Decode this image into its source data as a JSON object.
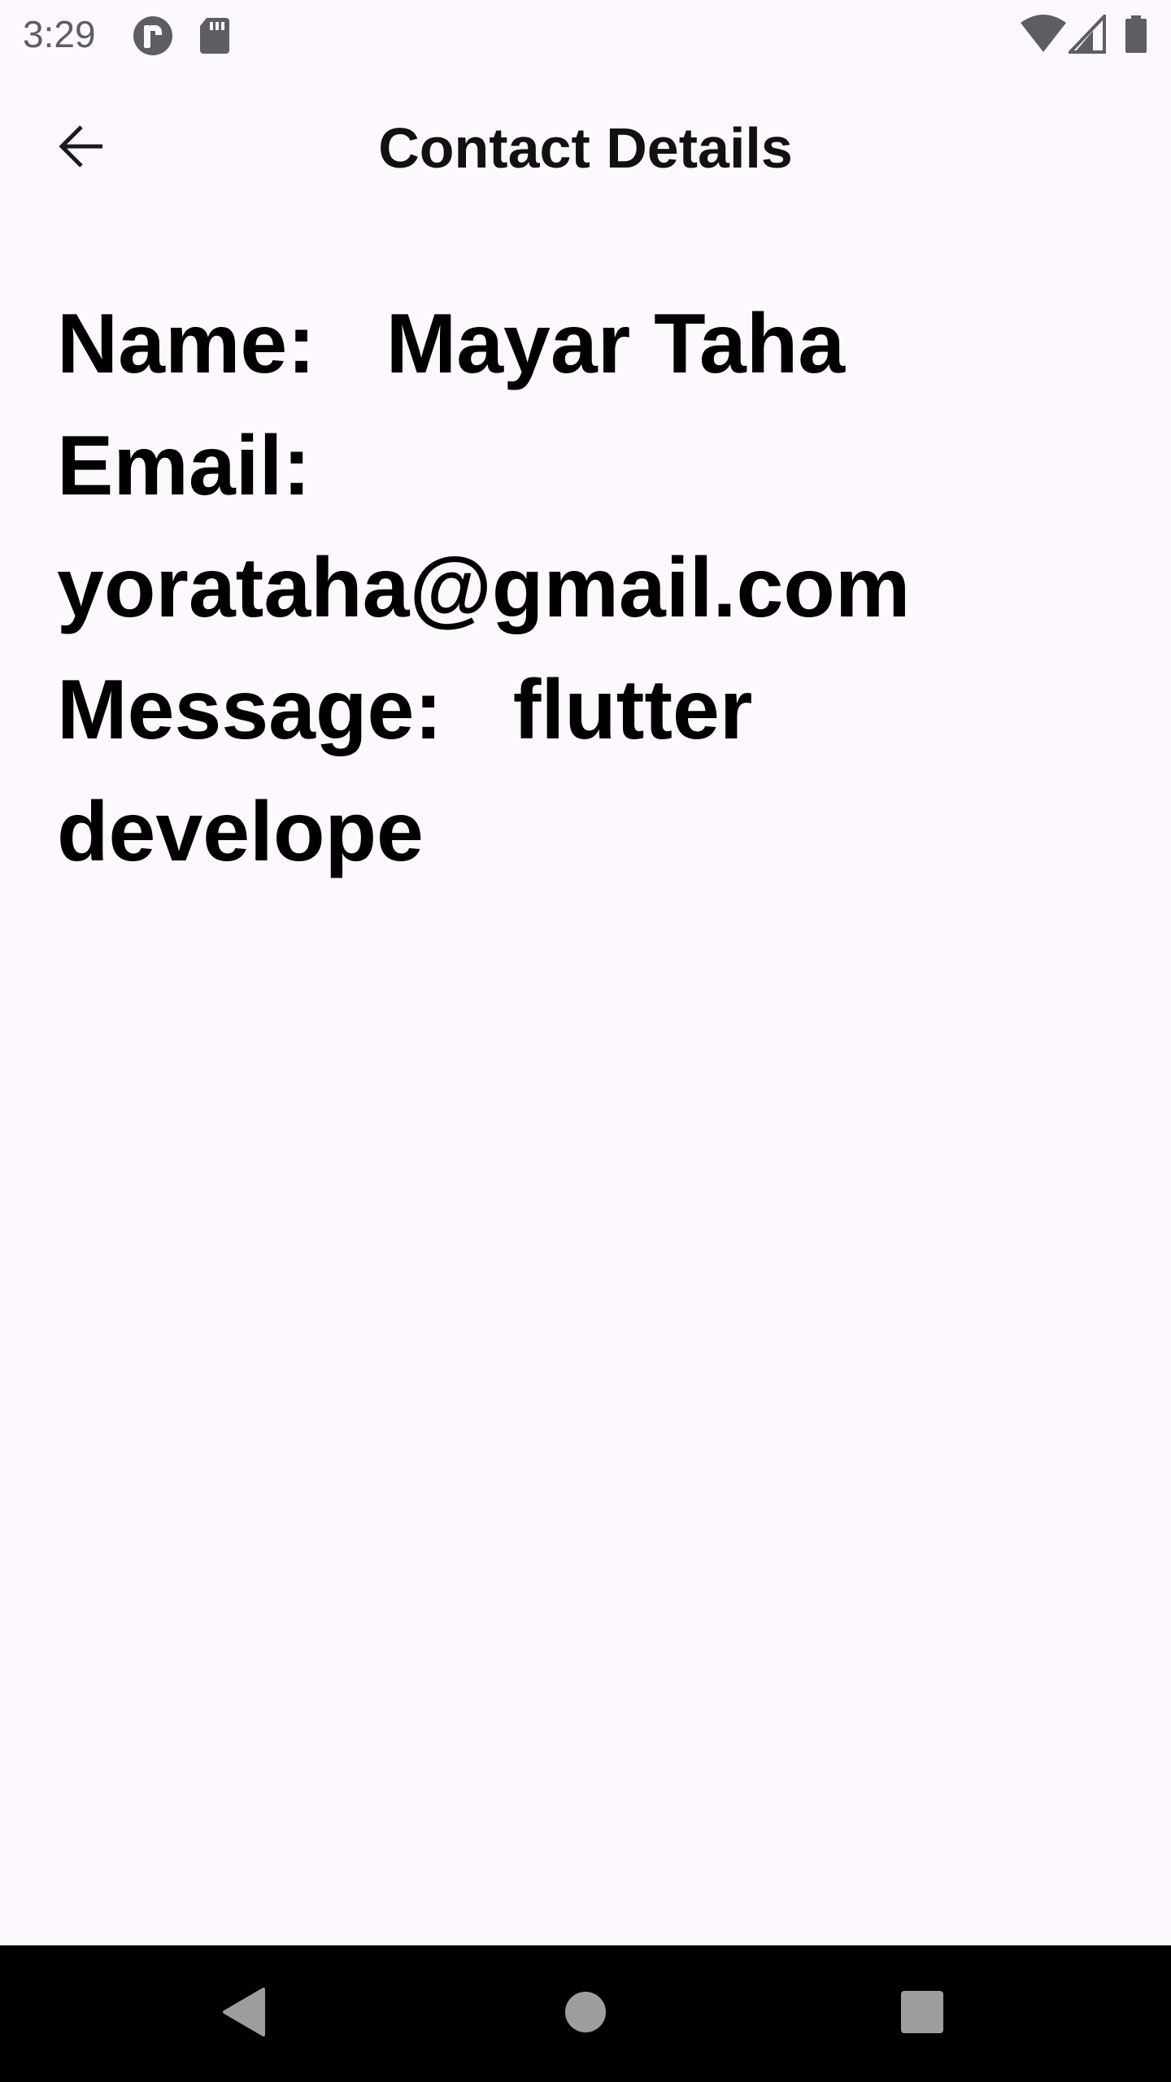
{
  "status_bar": {
    "time": "3:29",
    "left_icons": [
      "app-notification-icon",
      "sd-card-icon"
    ],
    "right_icons": [
      "wifi-icon",
      "cell-signal-icon",
      "battery-icon"
    ]
  },
  "app_bar": {
    "title": "Contact Details",
    "back_icon": "arrow-back-icon"
  },
  "contact": {
    "name_label": "Name:",
    "name_value": "Mayar Taha",
    "email_label": "Email:",
    "email_value": "yorataha@gmail.com",
    "message_label": "Message:",
    "message_value_line1": "flutter",
    "message_value_line2": "develope"
  },
  "nav_bar": {
    "icons": [
      "nav-back-icon",
      "nav-home-icon",
      "nav-recents-icon"
    ]
  },
  "colors": {
    "background": "#fdf7fe",
    "text": "#000000",
    "status_icons": "#5e5d64",
    "nav_bar": "#000000",
    "nav_icons": "#9e9e9e"
  }
}
